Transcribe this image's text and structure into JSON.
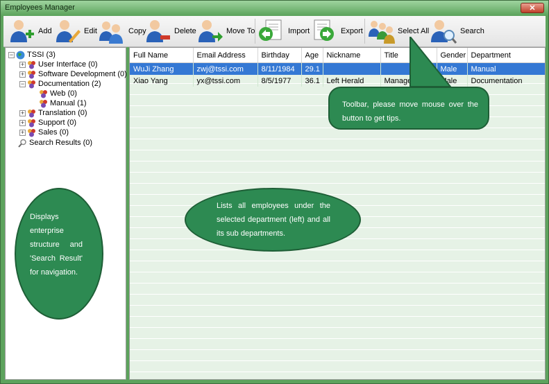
{
  "window": {
    "title": "Employees Manager",
    "close": "✕"
  },
  "toolbar": [
    {
      "label": "Add",
      "icon": "add-user-icon"
    },
    {
      "label": "Edit",
      "icon": "edit-user-icon"
    },
    {
      "label": "Copy",
      "icon": "copy-user-icon"
    },
    {
      "label": "Delete",
      "icon": "delete-user-icon"
    },
    {
      "label": "Move To",
      "icon": "move-user-icon"
    },
    {
      "label": "Import",
      "icon": "import-icon"
    },
    {
      "label": "Export",
      "icon": "export-icon"
    },
    {
      "label": "Select All",
      "icon": "select-all-icon"
    },
    {
      "label": "Search",
      "icon": "search-user-icon"
    }
  ],
  "tree": {
    "root": "TSSI (3)",
    "items": [
      "User Interface (0)",
      "Software Development (0)",
      "Documentation (2)",
      "Web (0)",
      "Manual (1)",
      "Translation (0)",
      "Support (0)",
      "Sales (0)"
    ],
    "search": "Search Results (0)"
  },
  "table": {
    "columns": [
      "Full Name",
      "Email Address",
      "Birthday",
      "Age",
      "Nickname",
      "Title",
      "Gender",
      "Department"
    ],
    "rows": [
      [
        "WuJi  Zhang",
        "zwj@tssi.com",
        "8/11/1984",
        "29.1",
        "",
        "",
        "Male",
        "Manual"
      ],
      [
        "Xiao  Yang",
        "yx@tssi.com",
        "8/5/1977",
        "36.1",
        "Left Herald",
        "Manager",
        "Male",
        "Documentation"
      ]
    ]
  },
  "callouts": {
    "toolbar": "Toolbar, please move mouse over the button to get tips.",
    "list": "Lists all employees under the selected department (left) and all its sub departments.",
    "tree": "Displays enterprise structure and 'Search Result' for navigation."
  },
  "colors": {
    "accent": "#2d8a52",
    "selection": "#3478d4",
    "window": "#5da35d"
  }
}
